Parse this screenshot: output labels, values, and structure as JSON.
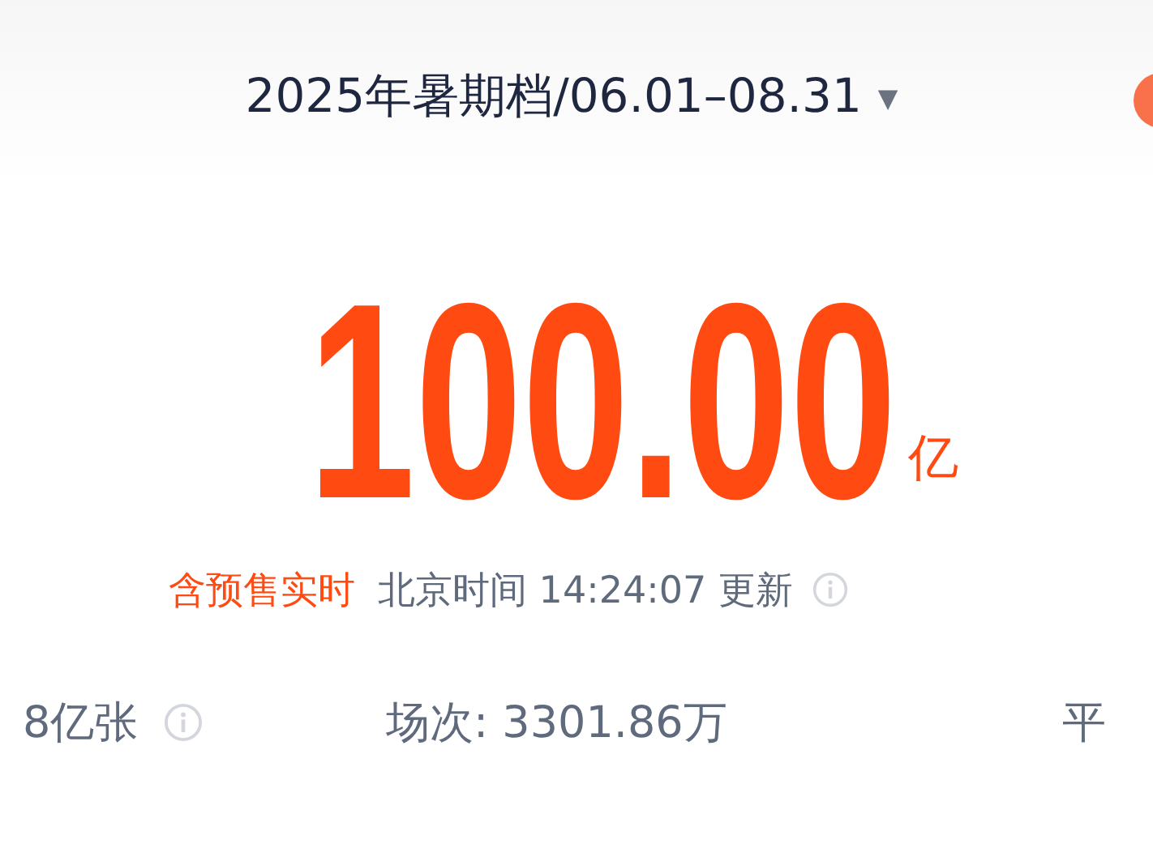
{
  "header": {
    "title": "2025年暑期档/06.01–08.31",
    "dropdown_caret": "▼"
  },
  "total": {
    "value": "100.00",
    "unit": "亿"
  },
  "update": {
    "tag": "含预售实时",
    "text": "北京时间 14:24:07 更新"
  },
  "stats": [
    {
      "text": "8亿张",
      "info": true
    },
    {
      "text": "场次: 3301.86万",
      "info": false
    },
    {
      "text": "平",
      "info": false
    }
  ]
}
